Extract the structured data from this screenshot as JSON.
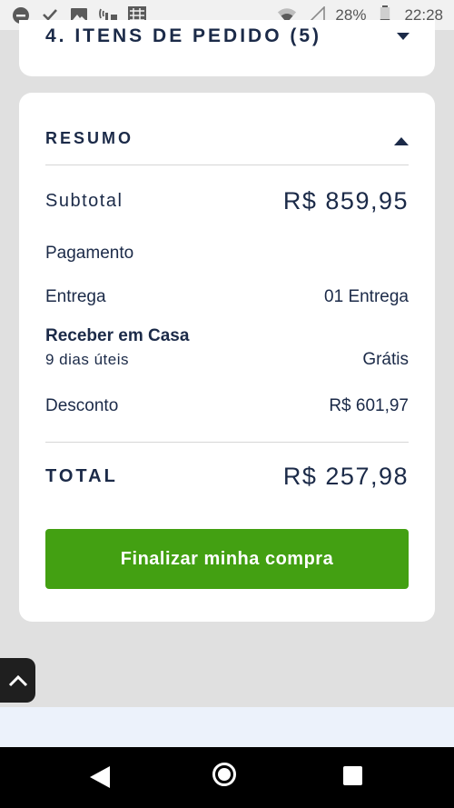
{
  "status_bar": {
    "battery": "28%",
    "time": "22:28",
    "icons": [
      "do-not-disturb-icon",
      "download-done-icon",
      "image-icon",
      "signal-tower-icon",
      "app-icon",
      "wifi-icon",
      "cell-signal-icon",
      "battery-icon"
    ]
  },
  "order_items": {
    "title": "4. ITENS DE PEDIDO (5)"
  },
  "summary": {
    "title": "RESUMO",
    "subtotal_label": "Subtotal",
    "subtotal_value": "R$ 859,95",
    "payment_label": "Pagamento",
    "delivery_label": "Entrega",
    "delivery_value": "01 Entrega",
    "shipping_method": "Receber em Casa",
    "shipping_time": "9 dias úteis",
    "shipping_price": "Grátis",
    "discount_label": "Desconto",
    "discount_value": "R$ 601,97",
    "total_label": "TOTAL",
    "total_value": "R$ 257,98",
    "checkout_button": "Finalizar minha compra"
  },
  "colors": {
    "accent_green": "#43a012",
    "text_navy": "#1b2a48",
    "background": "#e0e0e0"
  }
}
